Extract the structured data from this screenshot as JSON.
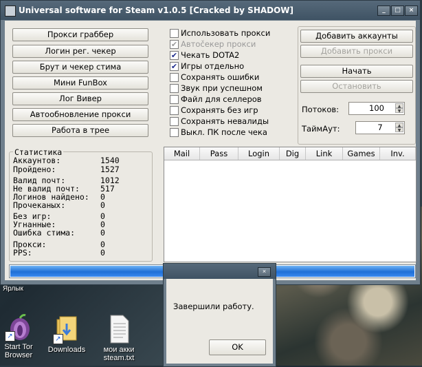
{
  "window": {
    "title": "Universal software for Steam v1.0.5  [Cracked by SHADOW]",
    "buttons": [
      "_",
      "□",
      "×"
    ]
  },
  "left_buttons": [
    "Прокси граббер",
    "Логин рег. чекер",
    "Брут и чекер стима",
    "Мини FunBox",
    "Лог Вивер",
    "Автообновление прокси",
    "Работа в трее"
  ],
  "checkboxes": [
    {
      "label": "Использовать прокси",
      "checked": false,
      "enabled": true
    },
    {
      "label": "Автočекер прокси",
      "checked": true,
      "enabled": false
    },
    {
      "label": "Чекать DOTA2",
      "checked": true,
      "enabled": true
    },
    {
      "label": "Игры отдельно",
      "checked": true,
      "enabled": true
    },
    {
      "label": "Сохранять ошибки",
      "checked": false,
      "enabled": true
    },
    {
      "label": "Звук при успешном",
      "checked": false,
      "enabled": true
    },
    {
      "label": "Файл для селлеров",
      "checked": false,
      "enabled": true
    },
    {
      "label": "Сохранять без игр",
      "checked": false,
      "enabled": true
    },
    {
      "label": "Сохранять невалиды",
      "checked": false,
      "enabled": true
    },
    {
      "label": "Выкл. ПК после чека",
      "checked": false,
      "enabled": true
    }
  ],
  "right_panel": {
    "add_accounts": "Добавить аккаунты",
    "add_proxies": "Добавить прокси",
    "start": "Начать",
    "stop": "Остановить",
    "threads_label": "Потоков:",
    "threads_value": "100",
    "timeout_label": "ТаймАут:",
    "timeout_value": "7"
  },
  "stats": {
    "title": "Статистика",
    "rows": [
      {
        "label": "Аккаунтов:",
        "value": "1540"
      },
      {
        "label": "Пройдено:",
        "value": "1527"
      },
      {
        "label": "Валид почт:",
        "value": "1012"
      },
      {
        "label": "Не валид почт:",
        "value": "517"
      },
      {
        "label": "Логинов найдено:",
        "value": "0"
      },
      {
        "label": "Прочеканых:",
        "value": "0"
      },
      {
        "label": "Без игр:",
        "value": "0"
      },
      {
        "label": "Угнанные:",
        "value": "0"
      },
      {
        "label": "Ошибка стима:",
        "value": "0"
      },
      {
        "label": "Прокси:",
        "value": "0"
      },
      {
        "label": "PPS:",
        "value": "0"
      }
    ]
  },
  "list": {
    "columns": [
      "Mail",
      "Pass",
      "Login",
      "Dig",
      "Link",
      "Games",
      "Inv."
    ]
  },
  "progress": {
    "fraction": 1.0
  },
  "dialog": {
    "message": "Завершили работу.",
    "ok": "OK"
  },
  "desktop": {
    "label_fragment": "Ярлык",
    "icons": [
      {
        "name": "tor-browser-icon",
        "label": "Start Tor Browser"
      },
      {
        "name": "folder-icon",
        "label": "Downloads"
      },
      {
        "name": "text-file-icon",
        "label": "мои акки steam.txt"
      }
    ]
  }
}
